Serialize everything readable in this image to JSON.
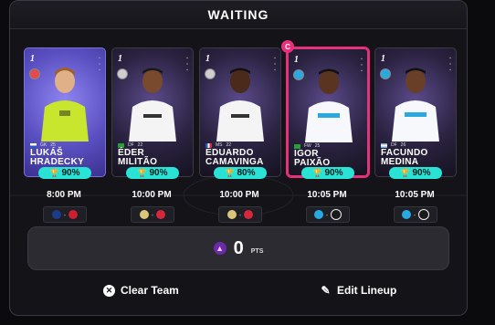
{
  "header": {
    "title": "WAITING"
  },
  "captain_badge": "C",
  "players": [
    {
      "rarity": "1",
      "name_line1": "LUKÁŠ",
      "name_line2": "HRADECKY",
      "position": "GK",
      "number": "25",
      "pct": "90%",
      "time": "8:00 PM",
      "kit": "yellow",
      "home": "#1e3a8a",
      "away": "#cc1f2f"
    },
    {
      "rarity": "1",
      "name_line1": "ÉDER",
      "name_line2": "MILITÃO",
      "position": "DF",
      "number": "22",
      "pct": "90%",
      "time": "10:00 PM",
      "kit": "white",
      "home": "#d9c67a",
      "away": "#d6283c"
    },
    {
      "rarity": "1",
      "name_line1": "EDUARDO",
      "name_line2": "CAMAVINGA",
      "position": "MS",
      "number": "22",
      "pct": "80%",
      "time": "10:00 PM",
      "kit": "white",
      "home": "#d9c67a",
      "away": "#d6283c"
    },
    {
      "rarity": "1",
      "name_line1": "IGOR",
      "name_line2": "PAIXÃO",
      "position": "FW",
      "number": "25",
      "pct": "90%",
      "time": "10:05 PM",
      "kit": "om",
      "home": "#2aa9e0",
      "away": "#1a1a1a"
    },
    {
      "rarity": "1",
      "name_line1": "FACUNDO",
      "name_line2": "MEDINA",
      "position": "DF",
      "number": "26",
      "pct": "90%",
      "time": "10:05 PM",
      "kit": "om",
      "home": "#2aa9e0",
      "away": "#1a1a1a"
    }
  ],
  "points": {
    "value": "0",
    "label": "PTS"
  },
  "actions": {
    "clear_label": "Clear Team",
    "edit_label": "Edit Lineup"
  },
  "colors": {
    "accent": "#29e3d6",
    "captain": "#e8317d",
    "boost": "#6b2aa8"
  }
}
